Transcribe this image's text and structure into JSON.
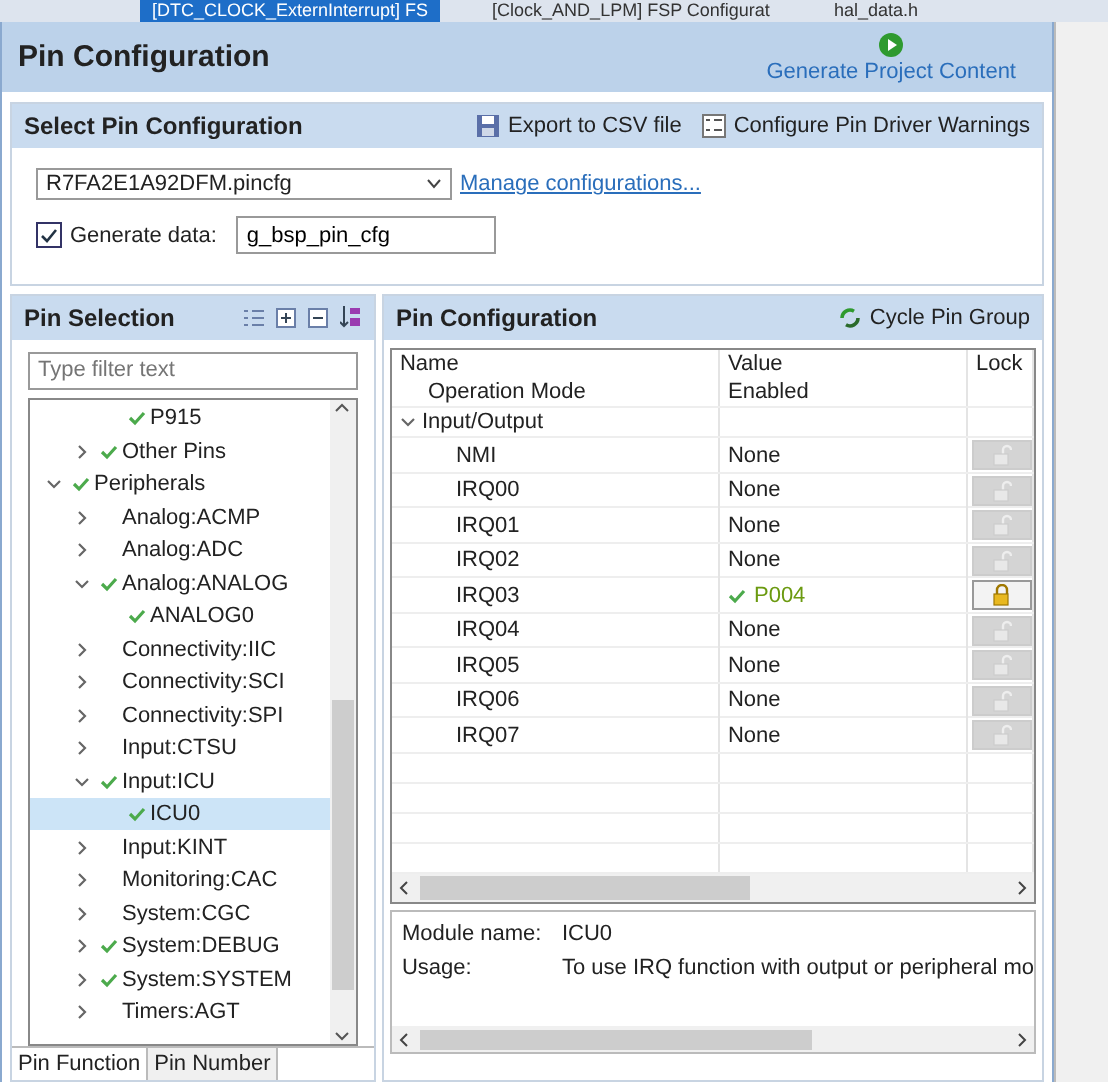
{
  "editor_tabs": [
    {
      "label": "[DTC_CLOCK_ExternInterrupt] FS",
      "selected": true
    },
    {
      "label": "[Clock_AND_LPM] FSP Configurat",
      "selected": false
    },
    {
      "label": "hal_data.h",
      "selected": false
    }
  ],
  "page_title": "Pin Configuration",
  "generate_link": "Generate Project Content",
  "select_section": {
    "title": "Select Pin Configuration",
    "actions": [
      "Export to CSV file",
      "Configure Pin Driver Warnings"
    ],
    "config_file": "R7FA2E1A92DFM.pincfg",
    "manage_link": "Manage configurations...",
    "generate_checked": true,
    "generate_label": "Generate data:",
    "generate_value": "g_bsp_pin_cfg"
  },
  "pin_selection": {
    "title": "Pin Selection",
    "filter_placeholder": "Type filter text",
    "tree": [
      {
        "kind": "hidden",
        "children": [
          {
            "kind": "hidden",
            "children": [
              {
                "kind": "leaf",
                "label": "P915",
                "checked": true,
                "selected": false
              }
            ]
          },
          {
            "kind": "group",
            "label": "Other Pins",
            "checked": true,
            "expanded": false,
            "selected": false
          }
        ]
      },
      {
        "kind": "group",
        "label": "Peripherals",
        "checked": true,
        "expanded": true,
        "selected": false,
        "children": [
          {
            "kind": "group",
            "label": "Analog:ACMP",
            "checked": false,
            "expanded": false,
            "selected": false
          },
          {
            "kind": "group",
            "label": "Analog:ADC",
            "checked": false,
            "expanded": false,
            "selected": false
          },
          {
            "kind": "group",
            "label": "Analog:ANALOG",
            "checked": true,
            "expanded": true,
            "selected": false,
            "children": [
              {
                "kind": "leaf",
                "label": "ANALOG0",
                "checked": true,
                "selected": false
              }
            ]
          },
          {
            "kind": "group",
            "label": "Connectivity:IIC",
            "checked": false,
            "expanded": false,
            "selected": false
          },
          {
            "kind": "group",
            "label": "Connectivity:SCI",
            "checked": false,
            "expanded": false,
            "selected": false
          },
          {
            "kind": "group",
            "label": "Connectivity:SPI",
            "checked": false,
            "expanded": false,
            "selected": false
          },
          {
            "kind": "group",
            "label": "Input:CTSU",
            "checked": false,
            "expanded": false,
            "selected": false
          },
          {
            "kind": "group",
            "label": "Input:ICU",
            "checked": true,
            "expanded": true,
            "selected": false,
            "children": [
              {
                "kind": "leaf",
                "label": "ICU0",
                "checked": true,
                "selected": true
              }
            ]
          },
          {
            "kind": "group",
            "label": "Input:KINT",
            "checked": false,
            "expanded": false,
            "selected": false
          },
          {
            "kind": "group",
            "label": "Monitoring:CAC",
            "checked": false,
            "expanded": false,
            "selected": false
          },
          {
            "kind": "group",
            "label": "System:CGC",
            "checked": false,
            "expanded": false,
            "selected": false
          },
          {
            "kind": "group",
            "label": "System:DEBUG",
            "checked": true,
            "expanded": false,
            "selected": false
          },
          {
            "kind": "group",
            "label": "System:SYSTEM",
            "checked": true,
            "expanded": false,
            "selected": false
          },
          {
            "kind": "group",
            "label": "Timers:AGT",
            "checked": false,
            "expanded": false,
            "selected": false
          }
        ]
      }
    ]
  },
  "pin_configuration": {
    "title": "Pin Configuration",
    "action": "Cycle Pin Group",
    "columns": [
      "Name",
      "Value",
      "Lock"
    ],
    "rows": [
      {
        "kind": "setting",
        "name": "Operation Mode",
        "value": "Enabled"
      },
      {
        "kind": "group",
        "name": "Input/Output",
        "expanded": true,
        "children": [
          {
            "kind": "pin",
            "name": "NMI",
            "value": "None",
            "assigned": false,
            "locked": false
          },
          {
            "kind": "pin",
            "name": "IRQ00",
            "value": "None",
            "assigned": false,
            "locked": false
          },
          {
            "kind": "pin",
            "name": "IRQ01",
            "value": "None",
            "assigned": false,
            "locked": false
          },
          {
            "kind": "pin",
            "name": "IRQ02",
            "value": "None",
            "assigned": false,
            "locked": false
          },
          {
            "kind": "pin",
            "name": "IRQ03",
            "value": "P004",
            "assigned": true,
            "locked": true
          },
          {
            "kind": "pin",
            "name": "IRQ04",
            "value": "None",
            "assigned": false,
            "locked": false
          },
          {
            "kind": "pin",
            "name": "IRQ05",
            "value": "None",
            "assigned": false,
            "locked": false
          },
          {
            "kind": "pin",
            "name": "IRQ06",
            "value": "None",
            "assigned": false,
            "locked": false
          },
          {
            "kind": "pin",
            "name": "IRQ07",
            "value": "None",
            "assigned": false,
            "locked": false
          }
        ]
      }
    ],
    "info": [
      {
        "label": "Module name:",
        "value": "ICU0"
      },
      {
        "label": "Usage:",
        "value": "To use IRQ function with output or peripheral mo"
      }
    ]
  },
  "bottom_tabs": [
    {
      "label": "Pin Function",
      "selected": true
    },
    {
      "label": "Pin Number",
      "selected": false
    }
  ]
}
